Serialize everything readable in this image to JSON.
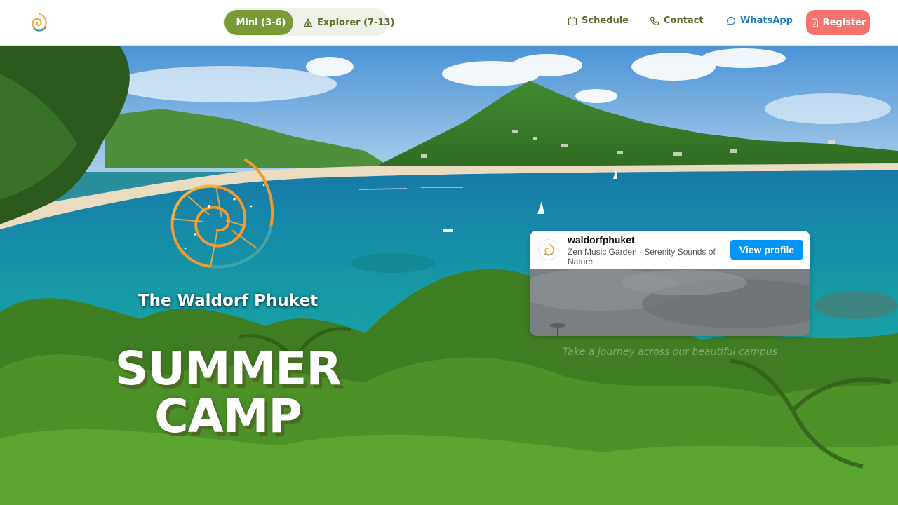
{
  "nav": {
    "age_tabs": [
      {
        "label": "Mini (3-6)",
        "icon": "palette-icon",
        "active": true
      },
      {
        "label": "Explorer (7-13)",
        "icon": "tent-icon",
        "active": false
      }
    ],
    "links": [
      {
        "label": "Schedule",
        "icon": "calendar-icon"
      },
      {
        "label": "Contact",
        "icon": "phone-icon"
      },
      {
        "label": "WhatsApp",
        "icon": "chat-bubble-icon"
      }
    ],
    "register_label": "Register",
    "colors": {
      "olive": "#5a6d2c",
      "active_tab": "#7a9a36",
      "whatsapp": "#1e7fc8",
      "register": "#f5726d"
    }
  },
  "hero": {
    "school_name": "The Waldorf Phuket",
    "camp_title_line1": "SUMMER",
    "camp_title_line2": "CAMP",
    "tagline": "Take a journey across our beautiful campus"
  },
  "instagram": {
    "username": "waldorfphuket",
    "subtitle": "Zen Music Garden · Serenity Sounds of Nature",
    "button_label": "View profile"
  }
}
